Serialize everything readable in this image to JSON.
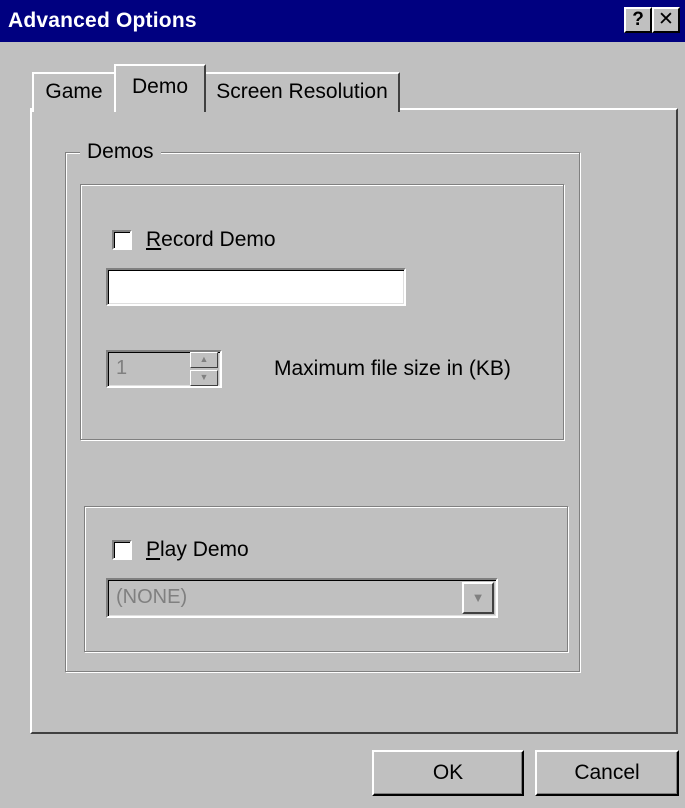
{
  "window": {
    "title": "Advanced Options",
    "help_glyph": "?",
    "close_glyph": "✕"
  },
  "tabs": [
    {
      "label": "Game",
      "selected": false
    },
    {
      "label": "Demo",
      "selected": true
    },
    {
      "label": "Screen Resolution",
      "selected": false
    }
  ],
  "demos": {
    "group_label": "Demos",
    "record": {
      "mnemonic": "R",
      "label_rest": "ecord Demo",
      "checked": false,
      "filename_value": ""
    },
    "max_size": {
      "value": "1",
      "label": "Maximum file size in (KB)"
    },
    "play": {
      "mnemonic": "P",
      "label_rest": "lay Demo",
      "checked": false,
      "selected_value": "(NONE)"
    }
  },
  "buttons": {
    "ok": "OK",
    "cancel": "Cancel"
  },
  "colors": {
    "titlebar": "#000080",
    "face": "#c0c0c0",
    "disabled_text": "#808080"
  }
}
